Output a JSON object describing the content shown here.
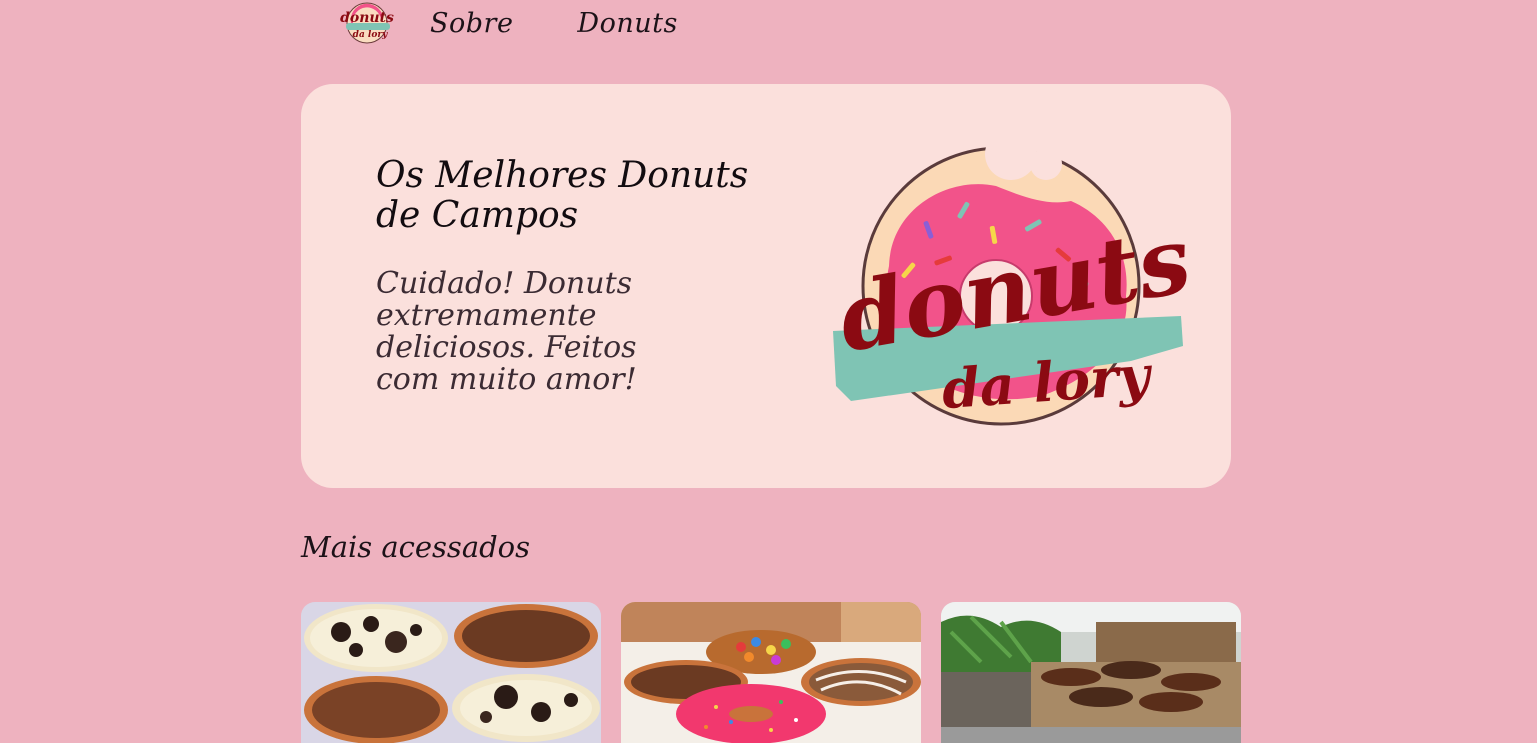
{
  "nav": {
    "logo_text_top": "donuts",
    "logo_text_bottom": "da lory",
    "links": [
      {
        "label": "Sobre"
      },
      {
        "label": "Donuts"
      }
    ]
  },
  "hero": {
    "title": "Os Melhores Donuts de Campos",
    "subtitle": "Cuidado! Donuts extremamente deliciosos. Feitos com muito amor!",
    "logo_text_top": "donuts",
    "logo_text_bottom": "da lory"
  },
  "section": {
    "title": "Mais acessados"
  },
  "colors": {
    "page_bg": "#eeb2bf",
    "hero_bg": "#fbe0dc",
    "logo_red": "#8b0a12",
    "icing_pink": "#f2538a",
    "teal": "#7fc4b4"
  }
}
